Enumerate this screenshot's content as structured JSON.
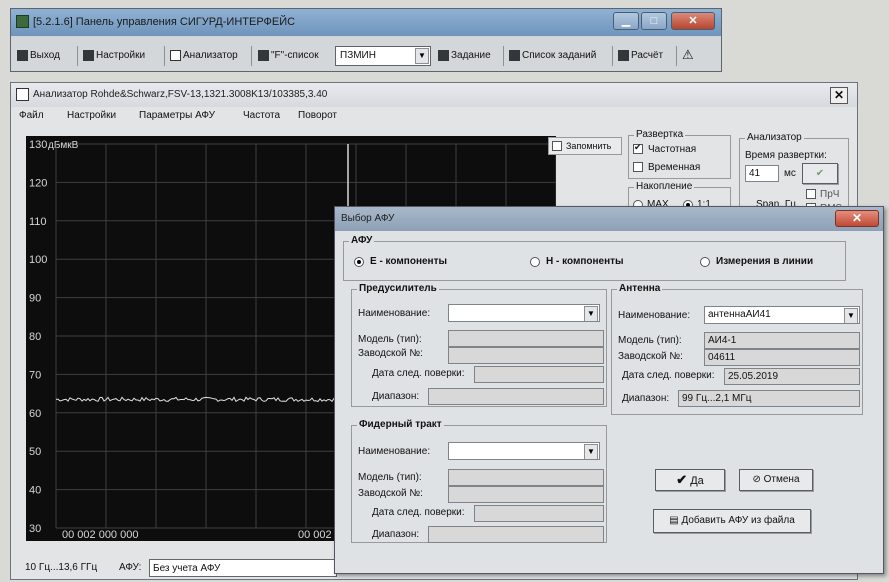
{
  "control_panel": {
    "title": "[5.2.1.6] Панель управления СИГУРД-ИНТЕРФЕЙС",
    "toolbar": {
      "exit": "Выход",
      "settings": "Настройки",
      "analyzer": "Анализатор",
      "f_list": "\"F\"-список",
      "f_list_value": "ПЗМИН",
      "task": "Задание",
      "task_list": "Список заданий",
      "calc": "Расчёт"
    }
  },
  "analyzer": {
    "title": "Анализатор Rohde&Schwarz,FSV-13,1321.3008K13/103385,3.40",
    "menu": [
      "Файл",
      "Настройки",
      "Параметры АФУ",
      "Частота",
      "Поворот"
    ],
    "remember": "Запомнить",
    "sweep": {
      "caption": "Развертка",
      "freq": "Частотная",
      "time": "Временная"
    },
    "accumulation": {
      "caption": "Накопление",
      "max": "MAX",
      "ratio": "1:1"
    },
    "analyzer_group": {
      "caption": "Анализатор",
      "sweep_time": "Время развертки:",
      "sweep_value": "41",
      "unit": "мс",
      "span": "Span, Гц",
      "prch": "ПрЧ",
      "rms": "RMS"
    },
    "status": {
      "range": "10 Гц...13,6 ГГц",
      "afu_label": "АФУ:",
      "afu_value": "Без учета АФУ"
    }
  },
  "chart_data": {
    "type": "line",
    "ylabel": "дБмкВ",
    "y_ticks": [
      130,
      120,
      110,
      100,
      90,
      80,
      70,
      60,
      50,
      40,
      30
    ],
    "ylim": [
      30,
      130
    ],
    "x_tick_labels": [
      "00 002 000 000",
      "00 002 ..."
    ],
    "series": [
      {
        "y_level": 63.5
      }
    ],
    "grid": true,
    "colors": {
      "background": "#0d0d0d",
      "grid": "#3e3e3e",
      "trace": "#e0e0e0",
      "marker": "#d6d6d6"
    }
  },
  "dialog": {
    "title": "Выбор АФУ",
    "afu_caption": "АФУ",
    "radio_e": "Е - компоненты",
    "radio_h": "Н - компоненты",
    "radio_line": "Измерения в линии",
    "preamp": {
      "caption": "Предусилитель",
      "name": "Наименование:",
      "model": "Модель (тип):",
      "serial": "Заводской №:",
      "next_check": "Дата след. поверки:",
      "range": "Диапазон:"
    },
    "antenna": {
      "caption": "Антенна",
      "name": "Наименование:",
      "name_value": "антеннаАИ41",
      "model": "Модель (тип):",
      "model_value": "АИ4-1",
      "serial": "Заводской №:",
      "serial_value": "04611",
      "next_check": "Дата след. поверки:",
      "next_check_value": "25.05.2019",
      "range": "Диапазон:",
      "range_value": "99 Гц...2,1 МГц"
    },
    "feeder": {
      "caption": "Фидерный тракт",
      "name": "Наименование:",
      "model": "Модель (тип):",
      "serial": "Заводской №:",
      "next_check": "Дата след. поверки:",
      "range": "Диапазон:"
    },
    "ok": "Да",
    "cancel": "Отмена",
    "add_from_file": "Добавить АФУ из файла"
  }
}
